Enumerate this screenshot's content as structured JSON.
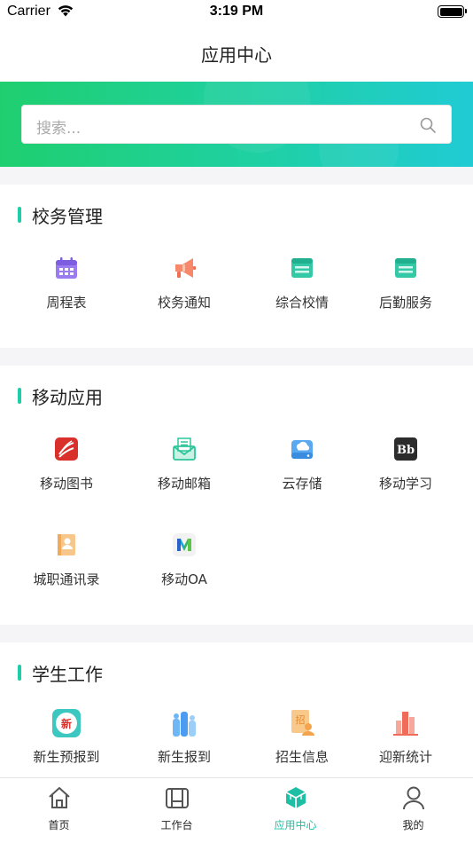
{
  "status_bar": {
    "carrier": "Carrier",
    "time": "3:19 PM"
  },
  "nav": {
    "title": "应用中心"
  },
  "search": {
    "placeholder": "搜索..."
  },
  "colors": {
    "accent": "#1fcea8",
    "banner_start": "#1fcf6f",
    "banner_end": "#20cbd4"
  },
  "sections": [
    {
      "title": "校务管理",
      "items": [
        {
          "label": "周程表",
          "icon": "calendar-icon"
        },
        {
          "label": "校务通知",
          "icon": "megaphone-icon"
        },
        {
          "label": "综合校情",
          "icon": "window-icon"
        },
        {
          "label": "后勤服务",
          "icon": "window-icon"
        }
      ]
    },
    {
      "title": "移动应用",
      "items": [
        {
          "label": "移动图书",
          "icon": "library-icon"
        },
        {
          "label": "移动邮箱",
          "icon": "mail-icon"
        },
        {
          "label": "云存储",
          "icon": "cloud-storage-icon"
        },
        {
          "label": "移动学习",
          "icon": "blackboard-icon"
        },
        {
          "label": "城职通讯录",
          "icon": "contacts-icon"
        },
        {
          "label": "移动OA",
          "icon": "oa-icon"
        }
      ]
    },
    {
      "title": "学生工作",
      "items": [
        {
          "label": "新生预报到",
          "icon": "new-student-icon"
        },
        {
          "label": "新生报到",
          "icon": "check-in-icon"
        },
        {
          "label": "招生信息",
          "icon": "enrollment-icon"
        },
        {
          "label": "迎新统计",
          "icon": "statistics-icon"
        }
      ]
    }
  ],
  "tabs": [
    {
      "label": "首页",
      "icon": "home-icon",
      "active": false
    },
    {
      "label": "工作台",
      "icon": "workbench-icon",
      "active": false
    },
    {
      "label": "应用中心",
      "icon": "app-center-icon",
      "active": true
    },
    {
      "label": "我的",
      "icon": "profile-icon",
      "active": false
    }
  ]
}
